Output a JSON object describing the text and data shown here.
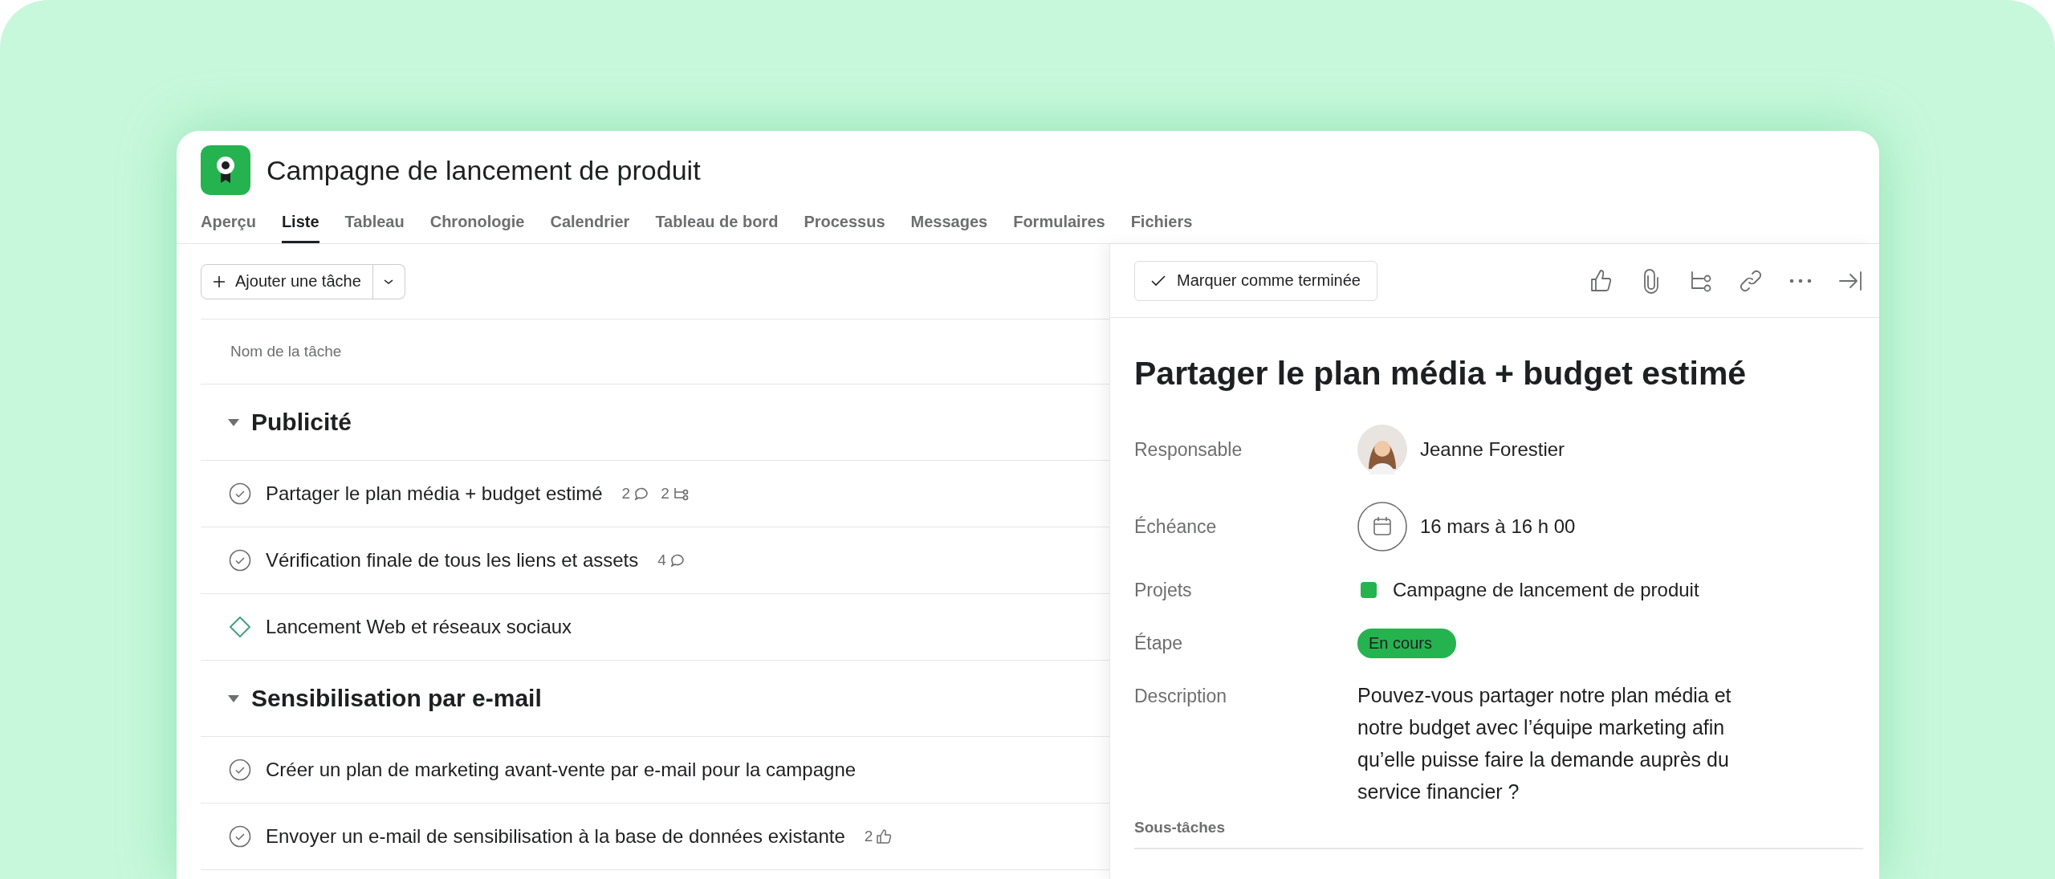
{
  "project": {
    "title": "Campagne de lancement de produit"
  },
  "tabs": [
    {
      "label": "Aperçu",
      "selected": false
    },
    {
      "label": "Liste",
      "selected": true
    },
    {
      "label": "Tableau",
      "selected": false
    },
    {
      "label": "Chronologie",
      "selected": false
    },
    {
      "label": "Calendrier",
      "selected": false
    },
    {
      "label": "Tableau de bord",
      "selected": false
    },
    {
      "label": "Processus",
      "selected": false
    },
    {
      "label": "Messages",
      "selected": false
    },
    {
      "label": "Formulaires",
      "selected": false
    },
    {
      "label": "Fichiers",
      "selected": false
    }
  ],
  "add_task_button": {
    "label": "Ajouter une tâche"
  },
  "list": {
    "column_header": "Nom de la tâche",
    "sections": [
      {
        "title": "Publicité",
        "expanded": true,
        "tasks": [
          {
            "name": "Partager le plan média + budget estimé",
            "kind": "task",
            "badges": [
              {
                "kind": "comments",
                "count": "2"
              },
              {
                "kind": "subtasks",
                "count": "2"
              }
            ]
          },
          {
            "name": "Vérification finale de tous les liens et assets",
            "kind": "task",
            "badges": [
              {
                "kind": "comments",
                "count": "4"
              }
            ]
          },
          {
            "name": "Lancement Web et réseaux sociaux",
            "kind": "milestone"
          }
        ]
      },
      {
        "title": "Sensibilisation par e-mail",
        "expanded": true,
        "tasks": [
          {
            "name": "Créer un plan de marketing avant-vente par e-mail pour la campagne",
            "kind": "task"
          },
          {
            "name": "Envoyer un e-mail de sensibilisation à la base de données existante",
            "kind": "task",
            "badges": [
              {
                "kind": "likes",
                "count": "2"
              }
            ]
          }
        ]
      }
    ]
  },
  "detail": {
    "complete_button": "Marquer comme terminée",
    "title": "Partager le plan média + budget estimé",
    "fields": [
      {
        "label": "Responsable",
        "kind": "person",
        "value": "Jeanne Forestier"
      },
      {
        "label": "Échéance",
        "kind": "date",
        "value": "16 mars à 16 h 00"
      },
      {
        "label": "Projets",
        "kind": "project",
        "value": "Campagne de lancement de produit",
        "color": "#25b350"
      },
      {
        "label": "Étape",
        "kind": "status",
        "value": "En cours",
        "color": "#25b350"
      },
      {
        "label": "Description",
        "kind": "text",
        "value": "Pouvez-vous partager notre plan média et notre budget avec l’équipe marketing afin qu’elle puisse faire la demande auprès du service financier ?"
      }
    ],
    "subtasks_heading": "Sous-tâches"
  }
}
